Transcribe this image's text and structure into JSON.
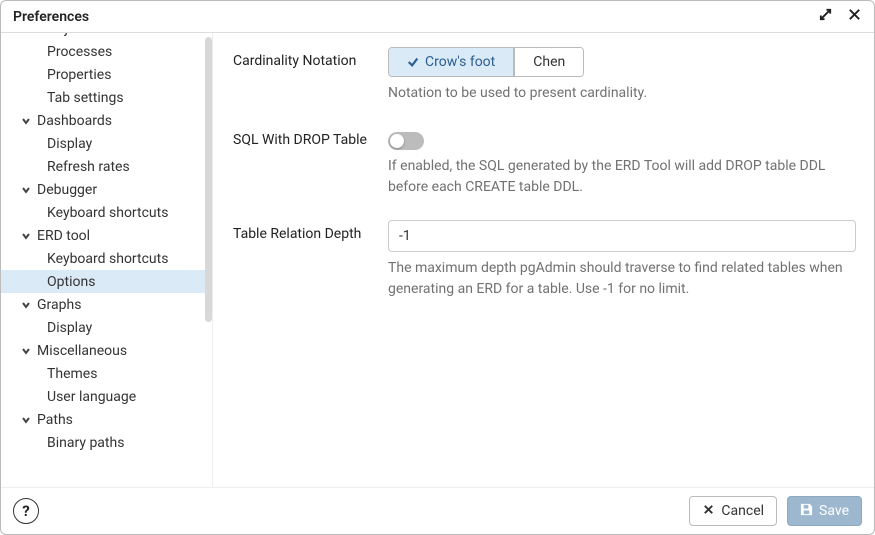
{
  "title": "Preferences",
  "sidebar": {
    "items": [
      {
        "type": "item",
        "label": "Object Breadcrumbs"
      },
      {
        "type": "item",
        "label": "Processes"
      },
      {
        "type": "item",
        "label": "Properties"
      },
      {
        "type": "item",
        "label": "Tab settings"
      },
      {
        "type": "group",
        "label": "Dashboards"
      },
      {
        "type": "item",
        "label": "Display"
      },
      {
        "type": "item",
        "label": "Refresh rates"
      },
      {
        "type": "group",
        "label": "Debugger"
      },
      {
        "type": "item",
        "label": "Keyboard shortcuts"
      },
      {
        "type": "group",
        "label": "ERD tool"
      },
      {
        "type": "item",
        "label": "Keyboard shortcuts"
      },
      {
        "type": "item",
        "label": "Options",
        "selected": true
      },
      {
        "type": "group",
        "label": "Graphs"
      },
      {
        "type": "item",
        "label": "Display"
      },
      {
        "type": "group",
        "label": "Miscellaneous"
      },
      {
        "type": "item",
        "label": "Themes"
      },
      {
        "type": "item",
        "label": "User language"
      },
      {
        "type": "group",
        "label": "Paths"
      },
      {
        "type": "item",
        "label": "Binary paths"
      }
    ]
  },
  "main": {
    "cardinality": {
      "label": "Cardinality Notation",
      "options": [
        "Crow's foot",
        "Chen"
      ],
      "selected": "Crow's foot",
      "help": "Notation to be used to present cardinality."
    },
    "drop": {
      "label": "SQL With DROP Table",
      "value": false,
      "help": "If enabled, the SQL generated by the ERD Tool will add DROP table DDL before each CREATE table DDL."
    },
    "depth": {
      "label": "Table Relation Depth",
      "value": "-1",
      "help": "The maximum depth pgAdmin should traverse to find related tables when generating an ERD for a table. Use -1 for no limit."
    }
  },
  "footer": {
    "help": "?",
    "cancel": "Cancel",
    "save": "Save"
  }
}
